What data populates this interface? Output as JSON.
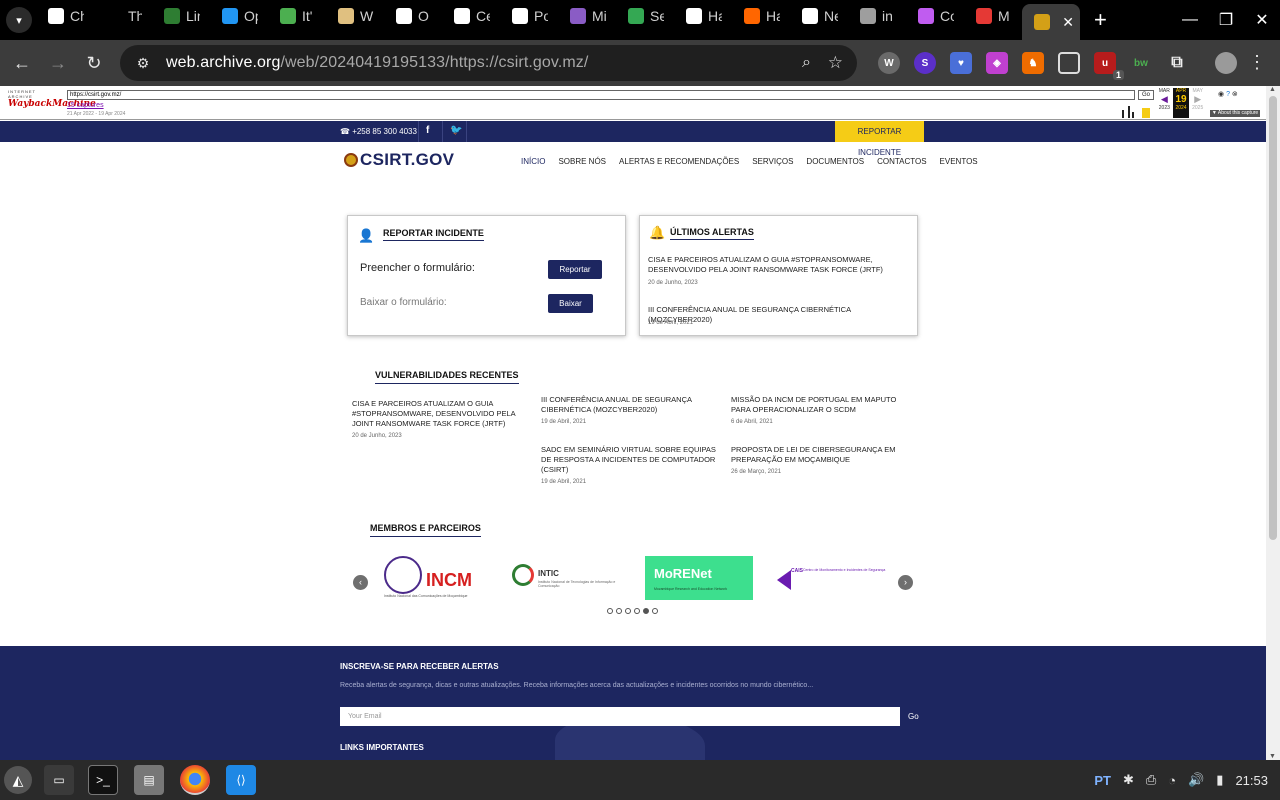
{
  "browser": {
    "tabs": [
      {
        "label": "Ch",
        "icon": "openai-icon",
        "color": "#ffffff"
      },
      {
        "label": "Th",
        "icon": "blank-icon",
        "color": "#000000"
      },
      {
        "label": "Lin",
        "icon": "link-icon",
        "color": "#2e7d32"
      },
      {
        "label": "Op",
        "icon": "gear-icon",
        "color": "#2196f3"
      },
      {
        "label": "It'",
        "icon": "globe-icon",
        "color": "#4caf50"
      },
      {
        "label": "W",
        "icon": "chess-icon",
        "color": "#e0c080"
      },
      {
        "label": "O",
        "icon": "openai-icon",
        "color": "#ffffff"
      },
      {
        "label": "Ce",
        "icon": "openai-icon",
        "color": "#ffffff"
      },
      {
        "label": "Po",
        "icon": "openai-icon",
        "color": "#ffffff"
      },
      {
        "label": "Mi",
        "icon": "dhs-icon",
        "color": "#8a5cc5"
      },
      {
        "label": "Se",
        "icon": "drive-icon",
        "color": "#34a853"
      },
      {
        "label": "Ha",
        "icon": "wikipedia-icon",
        "color": "#ffffff"
      },
      {
        "label": "Ha",
        "icon": "ycombinator-icon",
        "color": "#ff6600"
      },
      {
        "label": "Ne",
        "icon": "github-icon",
        "color": "#ffffff"
      },
      {
        "label": "in",
        "icon": "globe-icon",
        "color": "#9e9e9e"
      },
      {
        "label": "Co",
        "icon": "copilot-icon",
        "color": "#c05cf0"
      },
      {
        "label": "M",
        "icon": "calendar-icon",
        "color": "#e53935"
      },
      {
        "label": "",
        "icon": "mozambique-emblem-icon",
        "color": "#d4a017"
      }
    ],
    "url_host": "web.archive.org",
    "url_path": "/web/20240419195133/https://csirt.gov.mz/"
  },
  "wayback": {
    "url_field": "https://csirt.gov.mz/",
    "go": "Go",
    "captures": "15 captures",
    "range": "21 Apr 2022 - 19 Apr 2024",
    "cal_prev_month": "MAR",
    "cal_cur_month": "APR",
    "cal_next_month": "MAY",
    "cal_day": "19",
    "cal_prev_year": "2023",
    "cal_cur_year": "2024",
    "cal_next_year": "2025",
    "about": "▼ About this capture",
    "logo_line1": "INTERNET ARCHIVE",
    "logo_line2": "WaybackMachine"
  },
  "site": {
    "phone": "+258 85 300 4033",
    "report_button": "REPORTAR INCIDENTE",
    "brand": "CSIRT.GOV",
    "menu": [
      "INÍCIO",
      "SOBRE NÓS",
      "ALERTAS E RECOMENDAÇÕES",
      "SERVIÇOS",
      "DOCUMENTOS",
      "CONTACTOS",
      "EVENTOS"
    ],
    "report_card": {
      "title": "REPORTAR INCIDENTE",
      "fill_label": "Preencher  o formulário:",
      "fill_button": "Reportar",
      "download_label": "Baixar o formulário:",
      "download_button": "Baixar"
    },
    "alerts_card": {
      "title": "ÚLTIMOS ALERTAS",
      "items": [
        {
          "title": "CISA E PARCEIROS ATUALIZAM O GUIA #STOPRANSOMWARE, DESENVOLVIDO PELA JOINT RANSOMWARE TASK FORCE (JRTF)",
          "date": "20 de Junho, 2023"
        },
        {
          "title": "III CONFERÊNCIA ANUAL DE SEGURANÇA CIBERNÉTICA (MOZCYBER2020)",
          "date": "19 de Abril, 2021"
        }
      ]
    },
    "vulns_title": "VULNERABILIDADES RECENTES",
    "vulns": [
      {
        "title": "CISA E PARCEIROS ATUALIZAM O GUIA #STOPRANSOMWARE, DESENVOLVIDO PELA JOINT RANSOMWARE TASK FORCE (JRTF)",
        "date": "20 de Junho, 2023"
      },
      {
        "title": "III CONFERÊNCIA ANUAL DE SEGURANÇA CIBERNÉTICA (MOZCYBER2020)",
        "date": "19 de Abril, 2021"
      },
      {
        "title": "MISSÃO DA INCM DE PORTUGAL EM MAPUTO PARA OPERACIONALIZAR O SCDM",
        "date": "6 de Abril, 2021"
      },
      {
        "title": "SADC EM SEMINÁRIO VIRTUAL SOBRE EQUIPAS DE RESPOSTA A INCIDENTES DE COMPUTADOR (CSIRT)",
        "date": "19 de Abril, 2021"
      },
      {
        "title": "PROPOSTA DE LEI DE CIBERSEGURANÇA EM PREPARAÇÃO EM MOÇAMBIQUE",
        "date": "26 de Março, 2021"
      }
    ],
    "partners_title": "MEMBROS E PARCEIROS",
    "partners": [
      {
        "name": "INCM",
        "sub": "Instituto Nacional das Comunicações de Moçambique"
      },
      {
        "name": "INTIC",
        "sub": "Instituto Nacional de Tecnologias de Informação e Comunicação"
      },
      {
        "name": "MoRENet",
        "sub": "Mozambique Research and Education Network"
      },
      {
        "name": "CAIS",
        "sub": "Centro de Monitoramento e Incidentes de Segurança"
      }
    ],
    "footer": {
      "subscribe_title": "INSCREVA-SE PARA RECEBER ALERTAS",
      "subscribe_text": "Receba alertas de segurança, dicas e outras atualizações. Receba informações acerca das actualizações e incidentes ocorridos no mundo cibernético...",
      "email_placeholder": "Your Email",
      "go": "Go",
      "links_title": "LINKS IMPORTANTES"
    }
  },
  "taskbar": {
    "lang": "PT",
    "time": "21:53"
  },
  "colors": {
    "brand_navy": "#1d2660",
    "accent_yellow": "#f5cc16",
    "morenet_green": "#3ddf8e"
  }
}
